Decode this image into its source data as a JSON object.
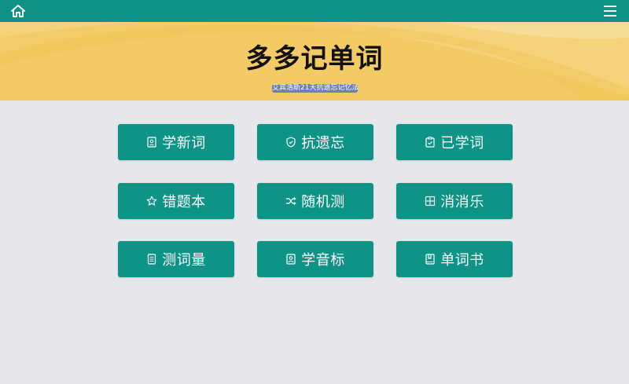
{
  "header": {
    "home_icon": "home-icon",
    "menu_icon": "hamburger-menu-icon",
    "bar_color": "#0e9486"
  },
  "hero": {
    "title": "多多记单词",
    "subtitle": "艾宾浩斯21天抗遗忘记忆法",
    "background_color": "#f3ca63",
    "badge_color": "#6e7fb7"
  },
  "menu_buttons": [
    {
      "label": "学新词",
      "icon": "vocabulary-card-icon"
    },
    {
      "label": "抗遗忘",
      "icon": "shield-icon"
    },
    {
      "label": "已学词",
      "icon": "checked-clipboard-icon"
    },
    {
      "label": "错题本",
      "icon": "star-icon"
    },
    {
      "label": "随机测",
      "icon": "shuffle-icon"
    },
    {
      "label": "消消乐",
      "icon": "grid-icon"
    },
    {
      "label": "测词量",
      "icon": "list-document-icon"
    },
    {
      "label": "学音标",
      "icon": "phonetic-card-icon"
    },
    {
      "label": "单词书",
      "icon": "bookmark-book-icon"
    }
  ],
  "colors": {
    "accent": "#0e9486",
    "page_background": "#e6e7eb"
  }
}
